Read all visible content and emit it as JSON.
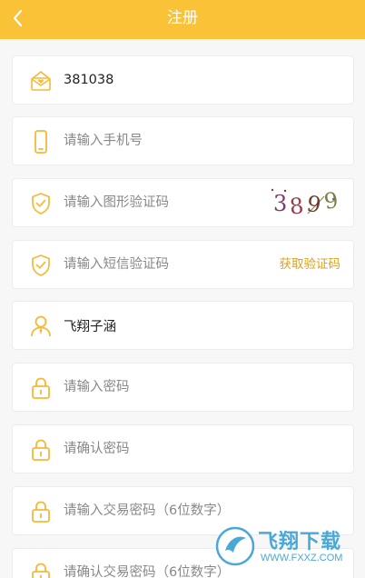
{
  "header": {
    "title": "注册"
  },
  "form": {
    "invite_code": {
      "value": "381038"
    },
    "phone": {
      "placeholder": "请输入手机号"
    },
    "image_code": {
      "placeholder": "请输入图形验证码",
      "captcha_chars": [
        "3",
        "8",
        "9",
        "9"
      ]
    },
    "sms_code": {
      "placeholder": "请输入短信验证码",
      "get_code_label": "获取验证码"
    },
    "nickname": {
      "value": "飞翔子涵"
    },
    "password": {
      "placeholder": "请输入密码"
    },
    "password_confirm": {
      "placeholder": "请确认密码"
    },
    "trade_password": {
      "placeholder": "请输入交易密码（6位数字）"
    },
    "trade_password_confirm": {
      "placeholder": "请确认交易密码（6位数字）"
    }
  },
  "watermark": {
    "name": "飞翔下载",
    "url": "WWW.FXXZ.COM"
  },
  "colors": {
    "accent": "#f9c237",
    "link": "#e0a01c",
    "watermark": "#4aa8d8"
  }
}
